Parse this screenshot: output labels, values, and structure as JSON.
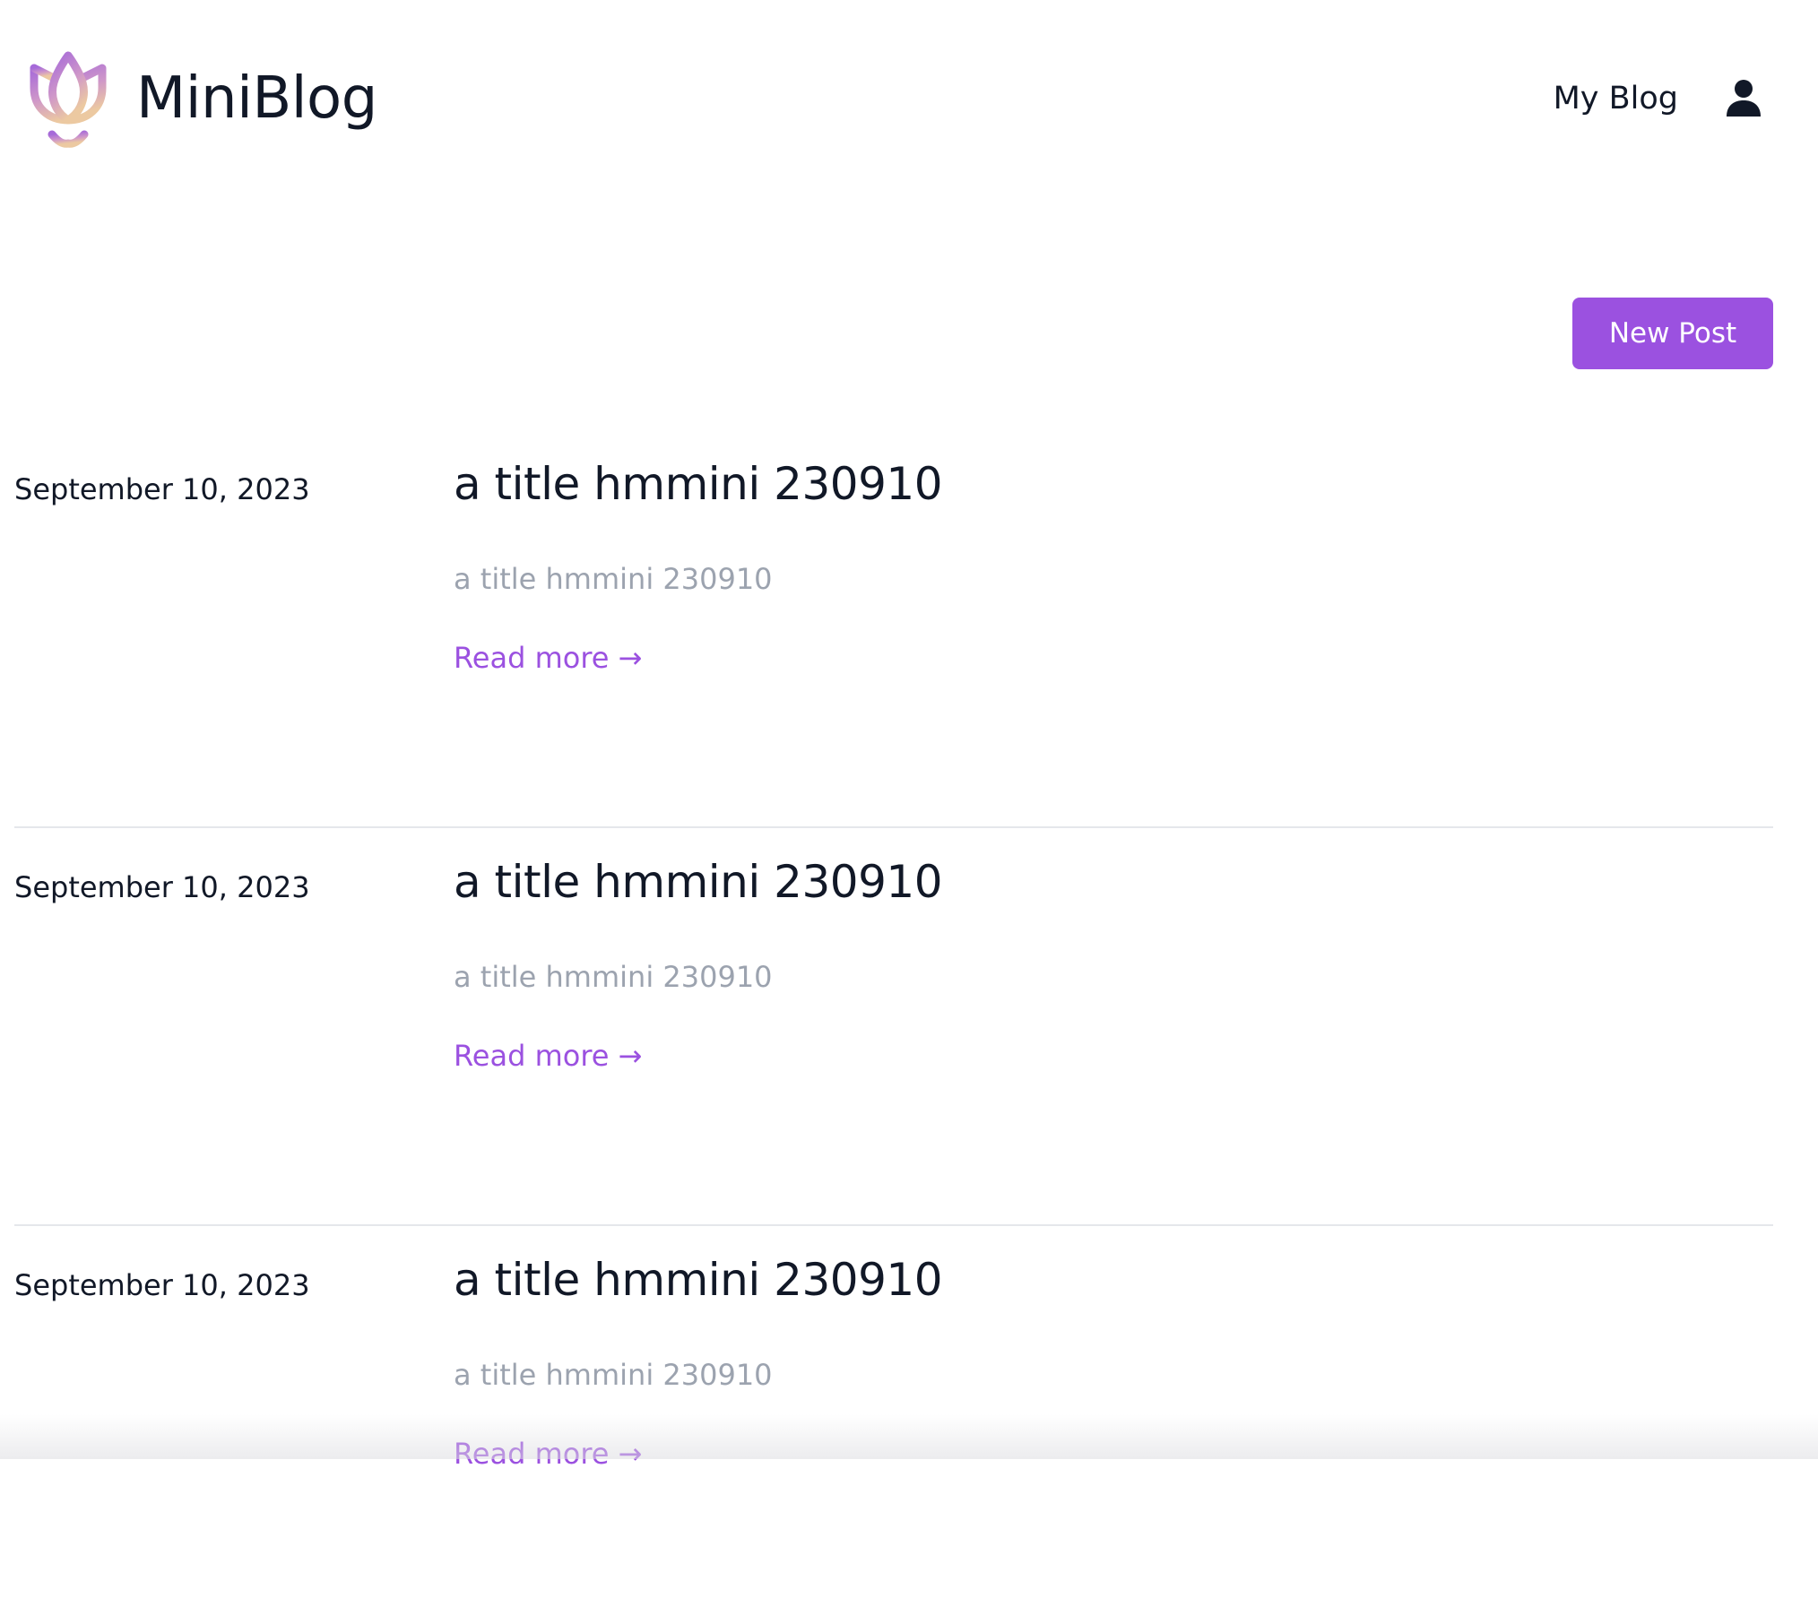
{
  "header": {
    "brand": "MiniBlog",
    "nav_link": "My Blog",
    "user_icon": "user-icon",
    "logo_icon": "tulip-logo-icon"
  },
  "toolbar": {
    "new_post_label": "New Post"
  },
  "colors": {
    "accent": "#9b51e0",
    "text": "#111827",
    "muted": "#9ca3af",
    "divider": "#e5e7eb"
  },
  "posts": [
    {
      "date": "September 10, 2023",
      "title": "a title hmmini 230910",
      "summary": "a title hmmini 230910",
      "read_more": "Read more",
      "arrow": "→"
    },
    {
      "date": "September 10, 2023",
      "title": "a title hmmini 230910",
      "summary": "a title hmmini 230910",
      "read_more": "Read more",
      "arrow": "→"
    },
    {
      "date": "September 10, 2023",
      "title": "a title hmmini 230910",
      "summary": "a title hmmini 230910",
      "read_more": "Read more",
      "arrow": "→"
    }
  ]
}
